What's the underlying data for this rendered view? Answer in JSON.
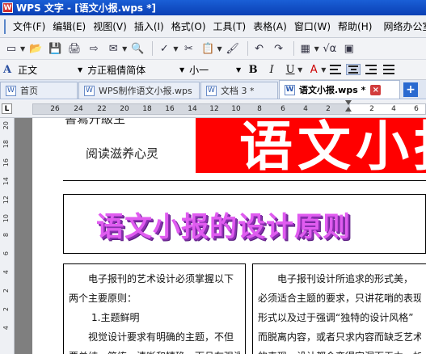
{
  "window": {
    "title": "WPS 文字 - [语文小报.wps *]",
    "app_icon_letter": "W"
  },
  "menu": {
    "items": [
      "文件(F)",
      "编辑(E)",
      "视图(V)",
      "插入(I)",
      "格式(O)",
      "工具(T)",
      "表格(A)",
      "窗口(W)",
      "帮助(H)",
      "网络办公室"
    ]
  },
  "format_bar": {
    "style": "正文",
    "font": "方正粗倩简体",
    "size": "小一",
    "bold": "B",
    "italic": "I",
    "underline": "U",
    "font_color": "A"
  },
  "tabs": [
    {
      "label": "首页",
      "icon": "W"
    },
    {
      "label": "WPS制作语文小报.wps",
      "icon": "W"
    },
    {
      "label": "文档 3 *",
      "icon": "W"
    },
    {
      "label": "语文小报.wps *",
      "icon": "W",
      "active": true
    }
  ],
  "ruler": {
    "corner": "L",
    "ticks": [
      "26",
      "24",
      "22",
      "20",
      "18",
      "16",
      "14",
      "12",
      "10",
      "8",
      "6",
      "4",
      "2",
      "2",
      "4",
      "6"
    ]
  },
  "vertical_ruler": {
    "ticks": [
      "20",
      "18",
      "16",
      "14",
      "12",
      "10",
      "8",
      "6",
      "4",
      "2",
      "2",
      "4"
    ]
  },
  "document": {
    "top_left_text": "書寫升級生",
    "reading_line": "阅读滋养心灵",
    "banner_text": "语文小报",
    "heading": "语文小报的设计原则",
    "left_column": {
      "lines": [
        "电子报刊的艺术设计必须掌握以下",
        "两个主要原则：",
        "1.主题鲜明",
        "视觉设计要求有明确的主题，不但",
        "要单纯、简练、清晰和精确，而且在强调"
      ]
    },
    "right_column": {
      "lines": [
        "电子报刊设计所追求的形式美，",
        "必须适合主题的要求，只讲花哨的表现",
        "形式以及过于强调“独特的设计风格”",
        "而脱离内容，或者只求内容而缺乏艺术",
        "的表现，设计都会变得空洞而无力。如"
      ]
    }
  },
  "colors": {
    "banner": "#ff0000",
    "heading": "#e05cf0",
    "titlebar": "#0a3fb4"
  }
}
